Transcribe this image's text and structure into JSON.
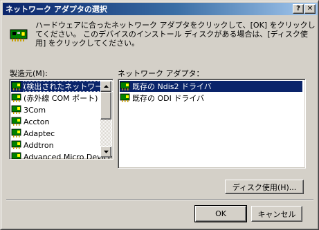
{
  "window": {
    "title": "ネットワーク アダプタの選択"
  },
  "titlebar": {
    "help_glyph": "?",
    "close_glyph": "✕"
  },
  "info": {
    "text": "ハードウェアに合ったネットワーク アダプタをクリックして、[OK] をクリックしてください。 このデバイスのインストール ディスクがある場合は、[ディスク使用] をクリックしてください。"
  },
  "manufacturers": {
    "label": "製造元(M):",
    "items": [
      "(検出されたネットワーク アダプタ)",
      "(赤外線 COM ポート)",
      "3Com",
      "Accton",
      "Adaptec",
      "Addtron",
      "Advanced Micro Devices"
    ],
    "selected_index": 0
  },
  "adapters": {
    "label": "ネットワーク アダプタ：",
    "items": [
      "既存の Ndis2 ドライバ",
      "既存の ODI ドライバ"
    ],
    "selected_index": 0
  },
  "buttons": {
    "have_disk": "ディスク使用(H)...",
    "ok": "OK",
    "cancel": "キャンセル"
  },
  "colors": {
    "title_active_start": "#0a246a",
    "title_active_end": "#a6caf0",
    "selection": "#0a246a",
    "face": "#d4d0c8"
  }
}
